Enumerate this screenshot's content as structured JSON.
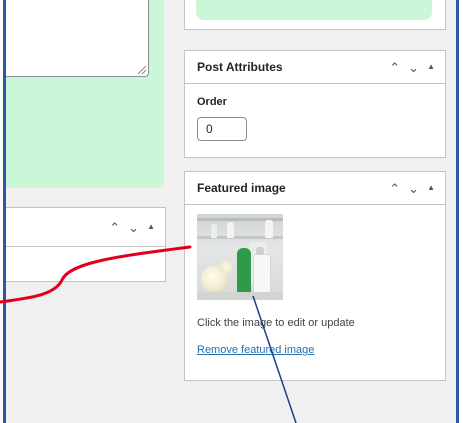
{
  "post_attributes": {
    "title": "Post Attributes",
    "order_label": "Order",
    "order_value": "0"
  },
  "featured_image": {
    "title": "Featured image",
    "help_text": "Click the image to edit or update",
    "remove_link": "Remove featured image"
  },
  "panel_controls": {
    "move_up": "^",
    "move_down": "v",
    "toggle": "▲"
  },
  "colors": {
    "frame_border": "#2f55a4",
    "panel_green": "#c9f7d7",
    "link": "#2271b1",
    "annotation_red": "#e0001b",
    "annotation_blue": "#1f3b8c"
  },
  "icons": [
    "chevron-up-icon",
    "chevron-down-icon",
    "collapse-triangle-icon",
    "resize-grip-icon"
  ]
}
